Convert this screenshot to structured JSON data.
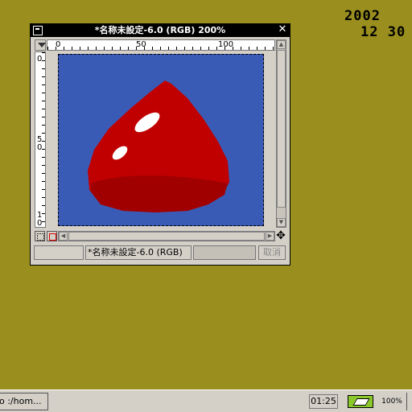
{
  "desktop": {
    "date_line1": "2002",
    "date_line2": "12 30"
  },
  "window": {
    "title": "*名称未設定-6.0 (RGB) 200%",
    "hruler_labels": [
      "0",
      "50",
      "100"
    ],
    "vruler_labels": [
      "0",
      "5\n0",
      "1\n0"
    ],
    "status_image_name": "*名称未設定-6.0 (RGB)",
    "cancel_label": "取消"
  },
  "taskbar": {
    "task_label": "o :/hom...",
    "clock": "01:25",
    "battery_percent": "100%"
  },
  "colors": {
    "desktop": "#9a8f1e",
    "canvas_bg": "#3a5bb5",
    "object": "#c00000",
    "object_shadow": "#a00000",
    "highlight": "#ffffff"
  }
}
